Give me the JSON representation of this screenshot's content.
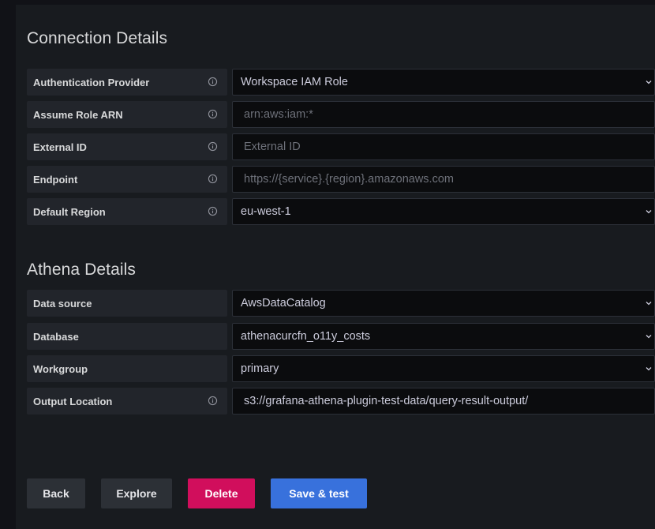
{
  "connection": {
    "title": "Connection Details",
    "rows": [
      {
        "label": "Authentication Provider",
        "value": "Workspace IAM Role",
        "placeholder": ""
      },
      {
        "label": "Assume Role ARN",
        "value": "",
        "placeholder": "arn:aws:iam:*"
      },
      {
        "label": "External ID",
        "value": "",
        "placeholder": "External ID"
      },
      {
        "label": "Endpoint",
        "value": "",
        "placeholder": "https://{service}.{region}.amazonaws.com"
      },
      {
        "label": "Default Region",
        "value": "eu-west-1",
        "placeholder": ""
      }
    ]
  },
  "athena": {
    "title": "Athena Details",
    "rows": [
      {
        "label": "Data source",
        "value": "AwsDataCatalog"
      },
      {
        "label": "Database",
        "value": "athenacurcfn_o11y_costs"
      },
      {
        "label": "Workgroup",
        "value": "primary"
      },
      {
        "label": "Output Location",
        "value": "s3://grafana-athena-plugin-test-data/query-result-output/"
      }
    ]
  },
  "buttons": {
    "back": "Back",
    "explore": "Explore",
    "delete": "Delete",
    "save": "Save & test"
  },
  "icons": {
    "info": "info-circle-icon",
    "chevron": "chevron-down-icon"
  },
  "colors": {
    "background": "#181b1f",
    "label_bg": "#22252b",
    "field_bg": "#0b0c0e",
    "primary": "#3871dc",
    "danger": "#d10e5c",
    "secondary": "#2c3036"
  }
}
